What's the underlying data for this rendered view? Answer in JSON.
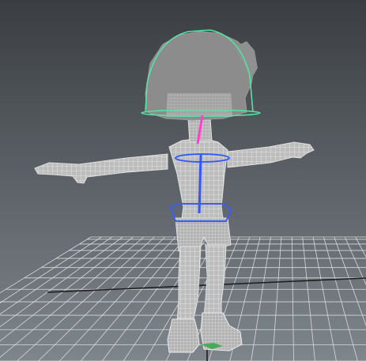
{
  "viewport": {
    "background_top": "#3a3e43",
    "background_bottom": "#7e858b"
  },
  "grid": {
    "line_color": "#d8dadc",
    "axis_color": "#1e1e1e"
  },
  "model": {
    "wire_fill": "#c9c9c9",
    "wire_stroke": "#e8e8e8",
    "hair_fill": "#8c8c8c"
  },
  "rig_controls": {
    "head_control_color": "#55e2a4",
    "neck_control_color": "#ff3fd0",
    "spine_control_color": "#2f56ff",
    "hip_control_color": "#3b5cff",
    "foot_control_color": "#3aa84a"
  }
}
